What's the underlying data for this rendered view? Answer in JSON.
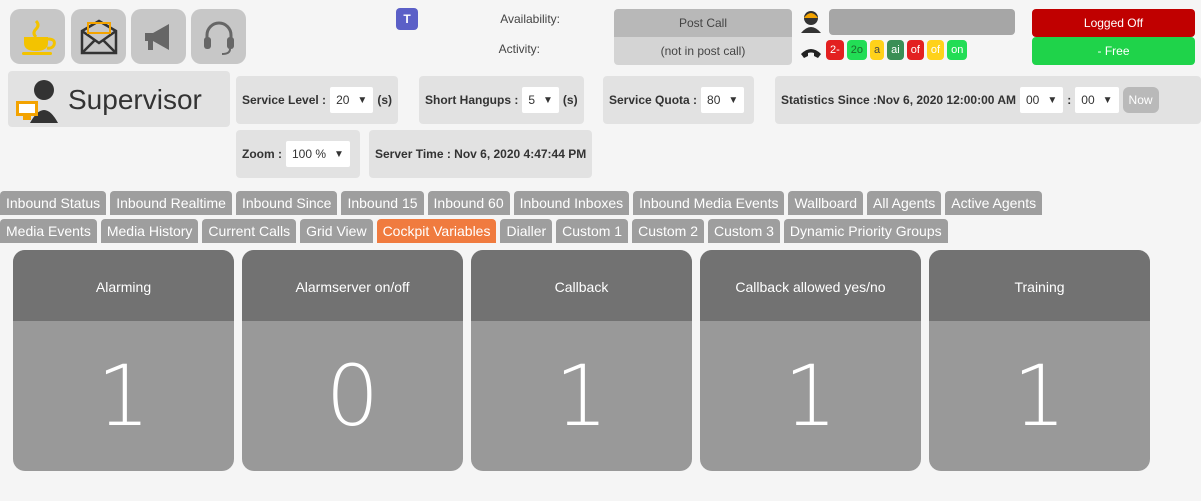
{
  "topbar": {
    "teams_letter": "T",
    "availability_label": "Availability:",
    "activity_label": "Activity:",
    "post_call_value": "Post Call",
    "post_call_status": "(not in post call)",
    "logged_status": "Logged Off",
    "free_status": "- Free",
    "chips": [
      {
        "label": "2-",
        "bg": "#e32020",
        "fg": "#ffffff"
      },
      {
        "label": "2o",
        "bg": "#22dd55",
        "fg": "#1a6a2a"
      },
      {
        "label": "a",
        "bg": "#ffd21a",
        "fg": "#444444"
      },
      {
        "label": "ai",
        "bg": "#3a8f55",
        "fg": "#ffffff"
      },
      {
        "label": "of",
        "bg": "#e32020",
        "fg": "#ffffff"
      },
      {
        "label": "of",
        "bg": "#ffd21a",
        "fg": "#ffffff"
      },
      {
        "label": "on",
        "bg": "#22dd55",
        "fg": "#ffffff"
      }
    ]
  },
  "supervisor": {
    "title": "Supervisor",
    "service_level_label": "Service Level :",
    "service_level_value": "20",
    "service_level_unit": "(s)",
    "short_hangups_label": "Short Hangups :",
    "short_hangups_value": "5",
    "short_hangups_unit": "(s)",
    "service_quota_label": "Service Quota :",
    "service_quota_value": "80",
    "stats_since_label": "Statistics Since :Nov 6, 2020 12:00:00 AM",
    "stats_hour": "00",
    "stats_sep": ":",
    "stats_minute": "00",
    "now_label": "Now",
    "zoom_label": "Zoom :",
    "zoom_value": "100 %",
    "server_time_label": "Server Time : Nov 6, 2020 4:47:44 PM"
  },
  "tabs_row1": [
    "Inbound Status",
    "Inbound Realtime",
    "Inbound Since",
    "Inbound 15",
    "Inbound 60",
    "Inbound Inboxes",
    "Inbound Media Events",
    "Wallboard",
    "All Agents",
    "Active Agents"
  ],
  "tabs_row2": [
    "Media Events",
    "Media History",
    "Current Calls",
    "Grid View",
    "Cockpit Variables",
    "Dialler",
    "Custom 1",
    "Custom 2",
    "Custom 3",
    "Dynamic Priority Groups"
  ],
  "active_tab": "Cockpit Variables",
  "cards": [
    {
      "title": "Alarming",
      "value": "1"
    },
    {
      "title": "Alarmserver on/off",
      "value": "0"
    },
    {
      "title": "Callback",
      "value": "1"
    },
    {
      "title": "Callback allowed yes/no",
      "value": "1"
    },
    {
      "title": "Training",
      "value": "1"
    }
  ]
}
